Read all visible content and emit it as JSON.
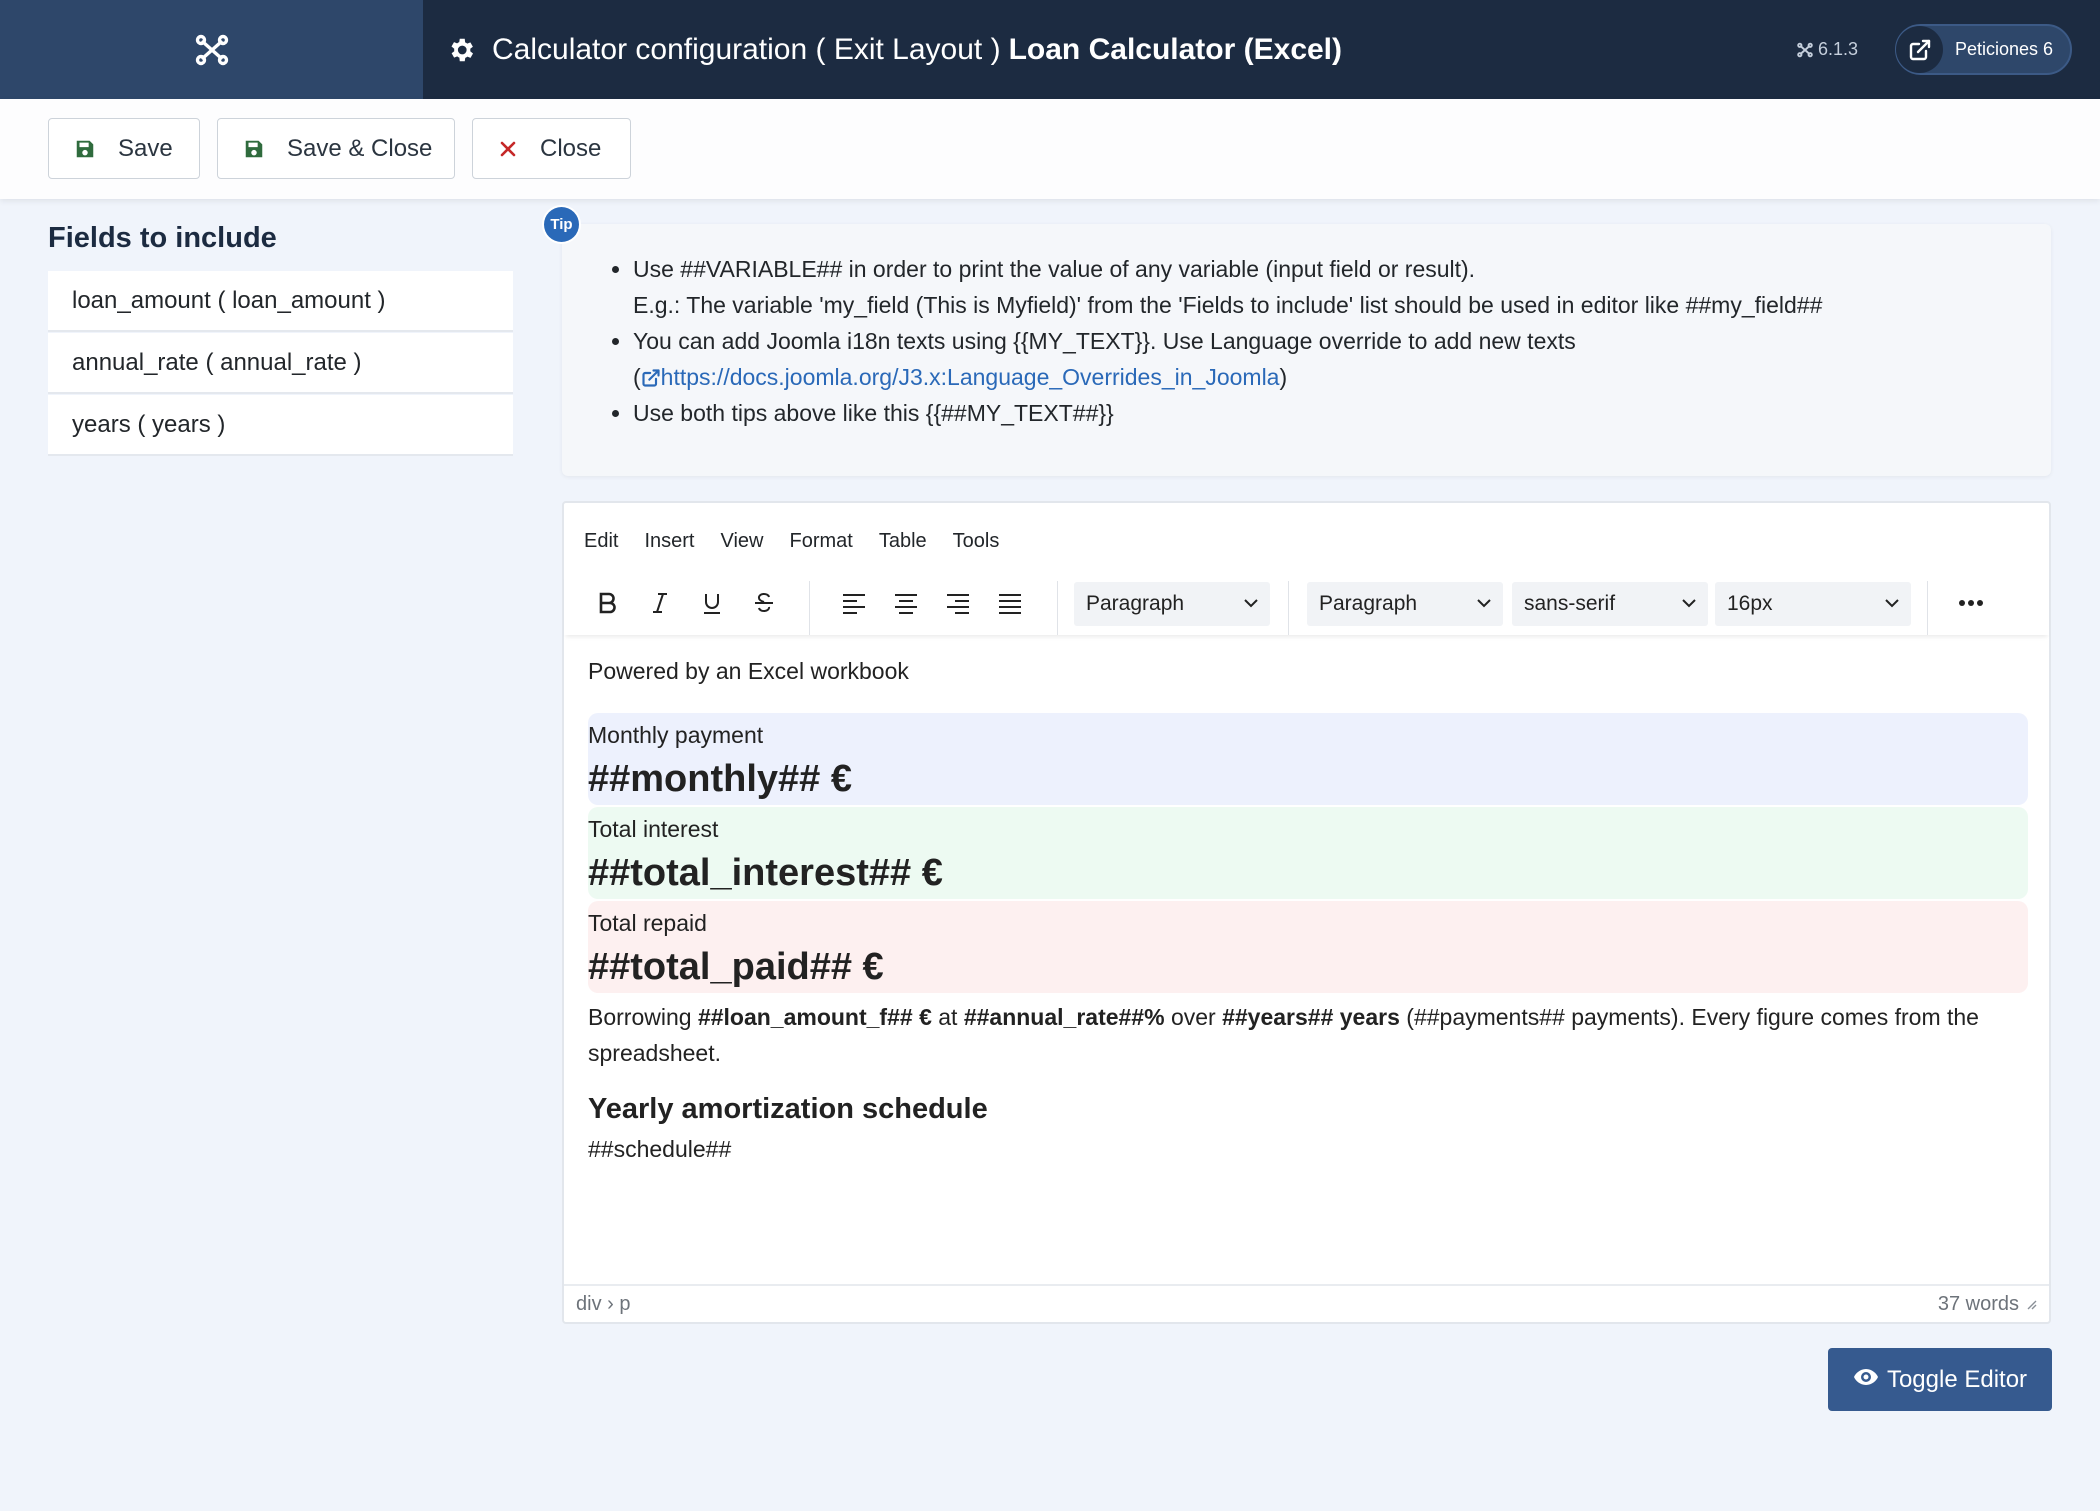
{
  "header": {
    "title_prefix": "Calculator configuration ( Exit Layout )",
    "title_bold": "Loan Calculator (Excel)",
    "version": "6.1.3",
    "requests_label": "Peticiones 6"
  },
  "toolbar": {
    "save_label": "Save",
    "save_close_label": "Save & Close",
    "close_label": "Close"
  },
  "fields": {
    "title": "Fields to include",
    "items": [
      {
        "label": "loan_amount ( loan_amount )"
      },
      {
        "label": "annual_rate ( annual_rate )"
      },
      {
        "label": "years ( years )"
      }
    ]
  },
  "tip": {
    "badge": "Tip",
    "line1": "Use ##VARIABLE## in order to print the value of any variable (input field or result).",
    "line1b": "E.g.: The variable 'my_field (This is Myfield)' from the 'Fields to include' list should be used in editor like ##my_field##",
    "line2": "You can add Joomla i18n texts using {{MY_TEXT}}. Use Language override to add new texts",
    "line2_link": "https://docs.joomla.org/J3.x:Language_Overrides_in_Joomla",
    "line3": "Use both tips above like this {{##MY_TEXT##}}"
  },
  "editor": {
    "menu": [
      "Edit",
      "Insert",
      "View",
      "Format",
      "Table",
      "Tools"
    ],
    "block_select": "Paragraph",
    "format_select": "Paragraph",
    "font_select": "sans-serif",
    "size_select": "16px",
    "content": {
      "intro": "Powered by an Excel workbook",
      "monthly_label": "Monthly payment",
      "monthly_value": "##monthly## €",
      "interest_label": "Total interest",
      "interest_value": "##total_interest## €",
      "paid_label": "Total repaid",
      "paid_value": "##total_paid## €",
      "summary_1": "Borrowing ",
      "summary_2": "##loan_amount_f## €",
      "summary_3": " at ",
      "summary_4": "##annual_rate##%",
      "summary_5": " over ",
      "summary_6": "##years## years",
      "summary_7": " (##payments## payments). Every figure comes from the spreadsheet.",
      "schedule_heading": "Yearly amortization schedule",
      "schedule_token": "##schedule##"
    },
    "status_path": "div › p",
    "word_count": "37 words"
  },
  "toggle_label": "Toggle Editor"
}
